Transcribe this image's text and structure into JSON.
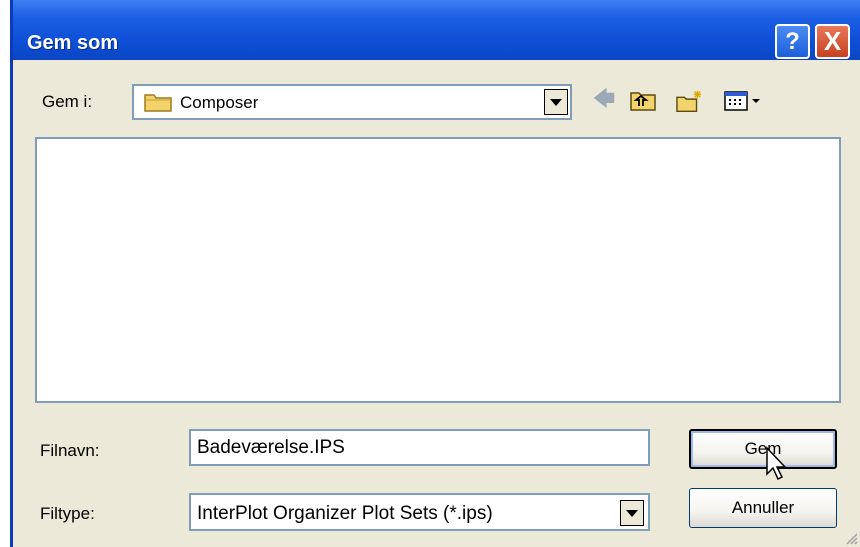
{
  "window": {
    "title": "Gem som"
  },
  "titlebar_buttons": {
    "help": "?",
    "close": "X"
  },
  "lookin": {
    "label": "Gem i:",
    "value": "Composer"
  },
  "toolbar": {
    "back_icon": "back-arrow-icon",
    "up_icon": "up-one-level-icon",
    "newfolder_icon": "new-folder-icon",
    "views_icon": "views-menu-icon"
  },
  "filename": {
    "label": "Filnavn:",
    "value": "Badeværelse.IPS"
  },
  "filetype": {
    "label": "Filtype:",
    "value": "InterPlot Organizer Plot Sets (*.ips)"
  },
  "buttons": {
    "save": "Gem",
    "cancel": "Annuller"
  },
  "colors": {
    "titlebar": "#0a46c4",
    "dialog_bg": "#ece9d8",
    "field_border": "#7f9db9",
    "close_btn": "#c7401e"
  }
}
